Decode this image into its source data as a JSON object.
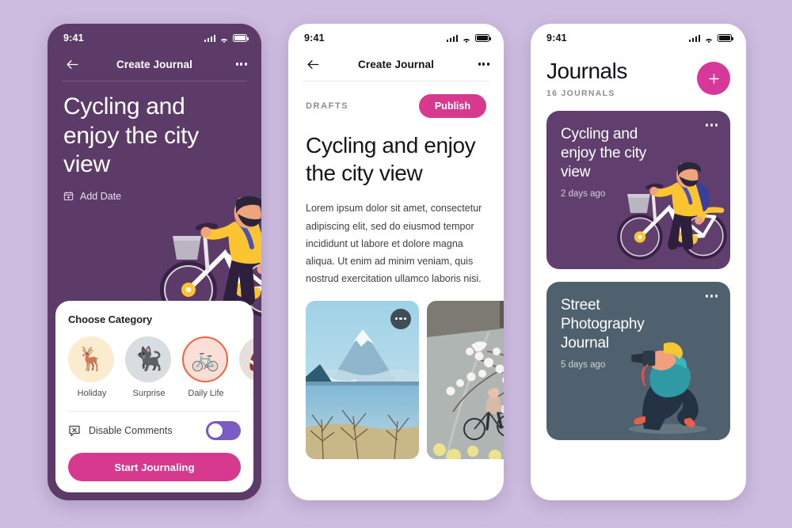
{
  "theme": {
    "page_bg": "#cdbcdf",
    "purple": "#5d3b68",
    "purple_card": "#603f6e",
    "pink": "#d6398e",
    "pink_fab": "#d6399a",
    "slate": "#4f616e",
    "toggle_on": "#7b5bc4",
    "selected_ring": "#f2613f"
  },
  "phone1": {
    "status": {
      "time": "9:41",
      "signal_icon": "signal-bars-icon",
      "wifi_icon": "wifi-icon",
      "battery_icon": "battery-icon"
    },
    "nav": {
      "back_icon": "arrow-left-icon",
      "title": "Create Journal",
      "more_icon": "more-horizontal-icon"
    },
    "hero": {
      "title": "Cycling and enjoy the city view",
      "date_label": "Add Date",
      "date_icon": "calendar-plus-icon",
      "illustration": "cyclist-illustration"
    },
    "category_card": {
      "heading": "Choose Category",
      "categories": [
        {
          "label": "Holiday",
          "emoji": "🦌",
          "icon": "deer-emoji-icon",
          "bg": "#fbeccf",
          "selected": false
        },
        {
          "label": "Surprise",
          "emoji": "🐈‍⬛",
          "icon": "black-cat-emoji-icon",
          "bg": "#d8dde2",
          "selected": false
        },
        {
          "label": "Daily Life",
          "emoji": "🚲",
          "icon": "bicycle-emoji-icon",
          "bg": "#fbdfd6",
          "selected": true
        },
        {
          "label": "Sport",
          "emoji": "🏈",
          "icon": "football-emoji-icon",
          "bg": "#e6dfdc",
          "selected": false
        }
      ],
      "option": {
        "label": "Disable Comments",
        "icon": "comment-off-icon",
        "toggle_state": "off"
      },
      "cta_label": "Start Journaling"
    }
  },
  "phone2": {
    "status": {
      "time": "9:41",
      "signal_icon": "signal-bars-icon",
      "wifi_icon": "wifi-icon",
      "battery_icon": "battery-icon"
    },
    "nav": {
      "back_icon": "arrow-left-icon",
      "title": "Create Journal",
      "more_icon": "more-horizontal-icon"
    },
    "draft_label": "DRAFTS",
    "publish_label": "Publish",
    "title": "Cycling and enjoy the city view",
    "body": "Lorem ipsum dolor sit amet, consectetur adipiscing elit, sed do eiusmod tempor incididunt ut labore et dolore magna aliqua. Ut enim ad minim veniam, quis nostrud exercitation ullamco laboris nisi.",
    "photos": [
      {
        "name": "photo-mount-fuji-lake",
        "more_icon": "more-horizontal-icon",
        "has_menu": true
      },
      {
        "name": "photo-cyclist-cherry-blossom-street",
        "has_menu": false
      }
    ]
  },
  "phone3": {
    "status": {
      "time": "9:41",
      "signal_icon": "signal-bars-icon",
      "wifi_icon": "wifi-icon",
      "battery_icon": "battery-icon"
    },
    "page_title": "Journals",
    "count_label": "16 JOURNALS",
    "add_icon": "plus-icon",
    "journals": [
      {
        "title": "Cycling and enjoy the city view",
        "ago": "2 days ago",
        "bg": "#603f6e",
        "more_icon": "more-horizontal-icon",
        "illustration": "cyclist-illustration"
      },
      {
        "title": "Street Photography Journal",
        "ago": "5 days ago",
        "bg": "#4f616e",
        "more_icon": "more-horizontal-icon",
        "illustration": "photographer-illustration"
      }
    ]
  }
}
